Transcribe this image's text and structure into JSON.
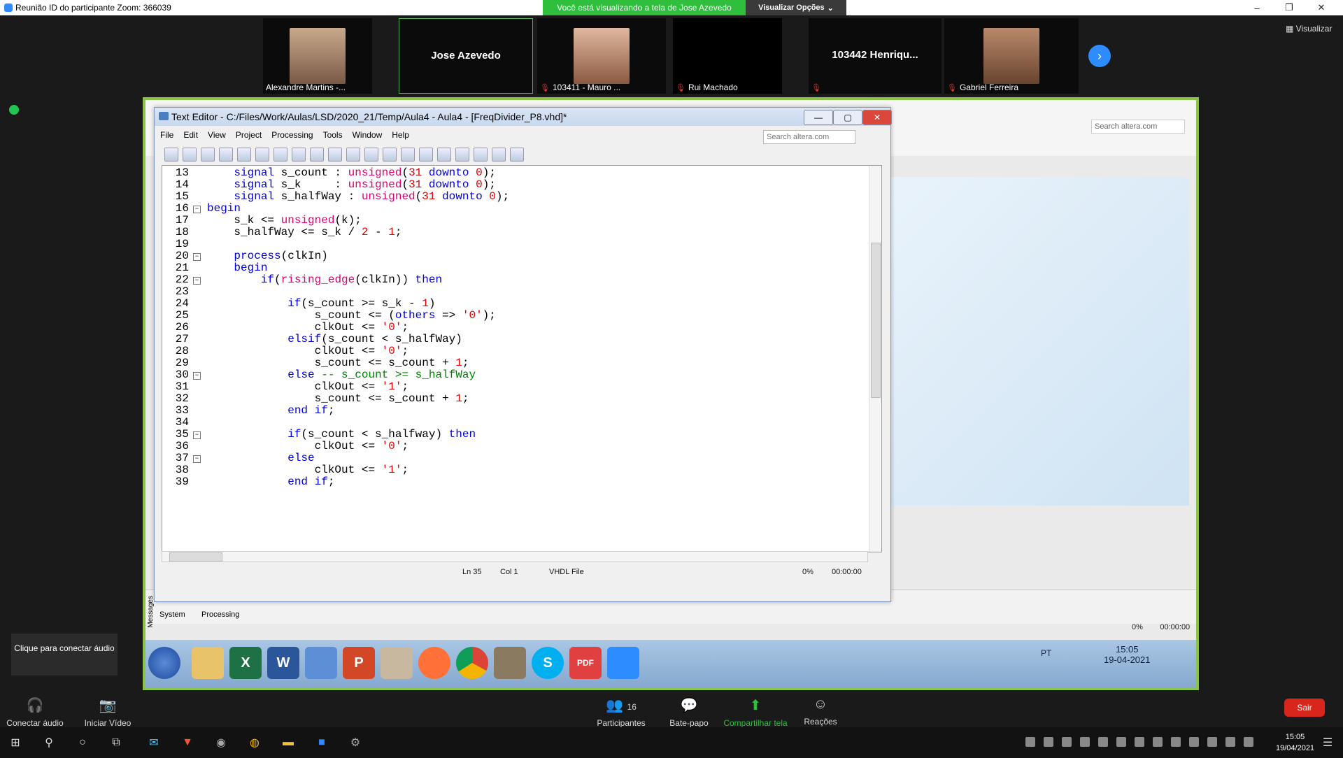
{
  "zoom": {
    "window_title": "Reunião ID do participante Zoom: 366039",
    "share_banner": "Você está visualizando a tela de Jose Azevedo",
    "view_options": "Visualizar Opções",
    "view_button": "Visualizar",
    "participants": [
      {
        "name": "Alexandre Martins -...",
        "muted": false,
        "has_photo": true
      },
      {
        "name": "Jose Azevedo",
        "muted": false,
        "has_photo": false,
        "active": true
      },
      {
        "name": "103411 - Mauro ...",
        "muted": true,
        "has_photo": true
      },
      {
        "name": "Rui Machado",
        "muted": true,
        "has_photo": false
      },
      {
        "name": "103442  Henriqu...",
        "muted": true,
        "has_photo": false
      },
      {
        "name": "Gabriel Ferreira",
        "muted": true,
        "has_photo": true
      }
    ],
    "audio_popup": "Clique para conectar áudio",
    "bottom_bar": {
      "connect_audio": "Conectar áudio",
      "start_video": "Iniciar Vídeo",
      "participants": "Participantes",
      "participants_count": "16",
      "chat": "Bate-papo",
      "share": "Compartilhar tela",
      "reactions": "Reações",
      "leave": "Sair"
    }
  },
  "editor": {
    "title": "Text Editor - C:/Files/Work/Aulas/LSD/2020_21/Temp/Aula4 - Aula4 - [FreqDivider_P8.vhd]*",
    "menu": [
      "File",
      "Edit",
      "View",
      "Project",
      "Processing",
      "Tools",
      "Window",
      "Help"
    ],
    "search_placeholder": "Search altera.com",
    "status": {
      "position": "Ln 35",
      "column": "Col 1",
      "file_type": "VHDL File",
      "percent": "0%",
      "time": "00:00:00"
    },
    "lines": [
      {
        "n": "13",
        "fold": "",
        "code": "    signal s_count : unsigned(31 downto 0);"
      },
      {
        "n": "14",
        "fold": "",
        "code": "    signal s_k     : unsigned(31 downto 0);"
      },
      {
        "n": "15",
        "fold": "",
        "code": "    signal s_halfWay : unsigned(31 downto 0);"
      },
      {
        "n": "16",
        "fold": "⊟",
        "code": "begin"
      },
      {
        "n": "17",
        "fold": "",
        "code": "    s_k <= unsigned(k);"
      },
      {
        "n": "18",
        "fold": "",
        "code": "    s_halfWay <= s_k / 2 - 1;"
      },
      {
        "n": "19",
        "fold": "",
        "code": ""
      },
      {
        "n": "20",
        "fold": "⊟",
        "code": "    process(clkIn)"
      },
      {
        "n": "21",
        "fold": "",
        "code": "    begin"
      },
      {
        "n": "22",
        "fold": "⊟",
        "code": "        if(rising_edge(clkIn)) then"
      },
      {
        "n": "23",
        "fold": "",
        "code": ""
      },
      {
        "n": "24",
        "fold": "",
        "code": "            if(s_count >= s_k - 1)"
      },
      {
        "n": "25",
        "fold": "",
        "code": "                s_count <= (others => '0');"
      },
      {
        "n": "26",
        "fold": "",
        "code": "                clkOut <= '0';"
      },
      {
        "n": "27",
        "fold": "",
        "code": "            elsif(s_count < s_halfWay)"
      },
      {
        "n": "28",
        "fold": "",
        "code": "                clkOut <= '0';"
      },
      {
        "n": "29",
        "fold": "",
        "code": "                s_count <= s_count + 1;"
      },
      {
        "n": "30",
        "fold": "⊟",
        "code": "            else -- s_count >= s_halfWay"
      },
      {
        "n": "31",
        "fold": "",
        "code": "                clkOut <= '1';"
      },
      {
        "n": "32",
        "fold": "",
        "code": "                s_count <= s_count + 1;"
      },
      {
        "n": "33",
        "fold": "",
        "code": "            end if;"
      },
      {
        "n": "34",
        "fold": "",
        "code": ""
      },
      {
        "n": "35",
        "fold": "⊟",
        "code": "            if(s_count < s_halfway) then"
      },
      {
        "n": "36",
        "fold": "",
        "code": "                clkOut <= '0';"
      },
      {
        "n": "37",
        "fold": "⊟",
        "code": "            else"
      },
      {
        "n": "38",
        "fold": "",
        "code": "                clkOut <= '1';"
      },
      {
        "n": "39",
        "fold": "",
        "code": "            end if;"
      }
    ]
  },
  "background_app": {
    "search_placeholder": "Search altera.com",
    "messages_label": "Messages",
    "tabs": [
      "System",
      "Processing"
    ],
    "status_percent": "0%",
    "status_time": "00:00:00"
  },
  "remote_taskbar": {
    "language": "PT",
    "time": "15:05",
    "date": "19-04-2021"
  },
  "windows_taskbar": {
    "time": "15:05",
    "date": "19/04/2021"
  },
  "colors": {
    "share_banner": "#2fbf3d",
    "zoom_blue": "#2d8cff",
    "leave_red": "#d9261c",
    "vhdl_keyword": "#0000e0",
    "vhdl_number": "#e00000",
    "vhdl_function": "#e00070",
    "vhdl_comment": "#008000"
  }
}
